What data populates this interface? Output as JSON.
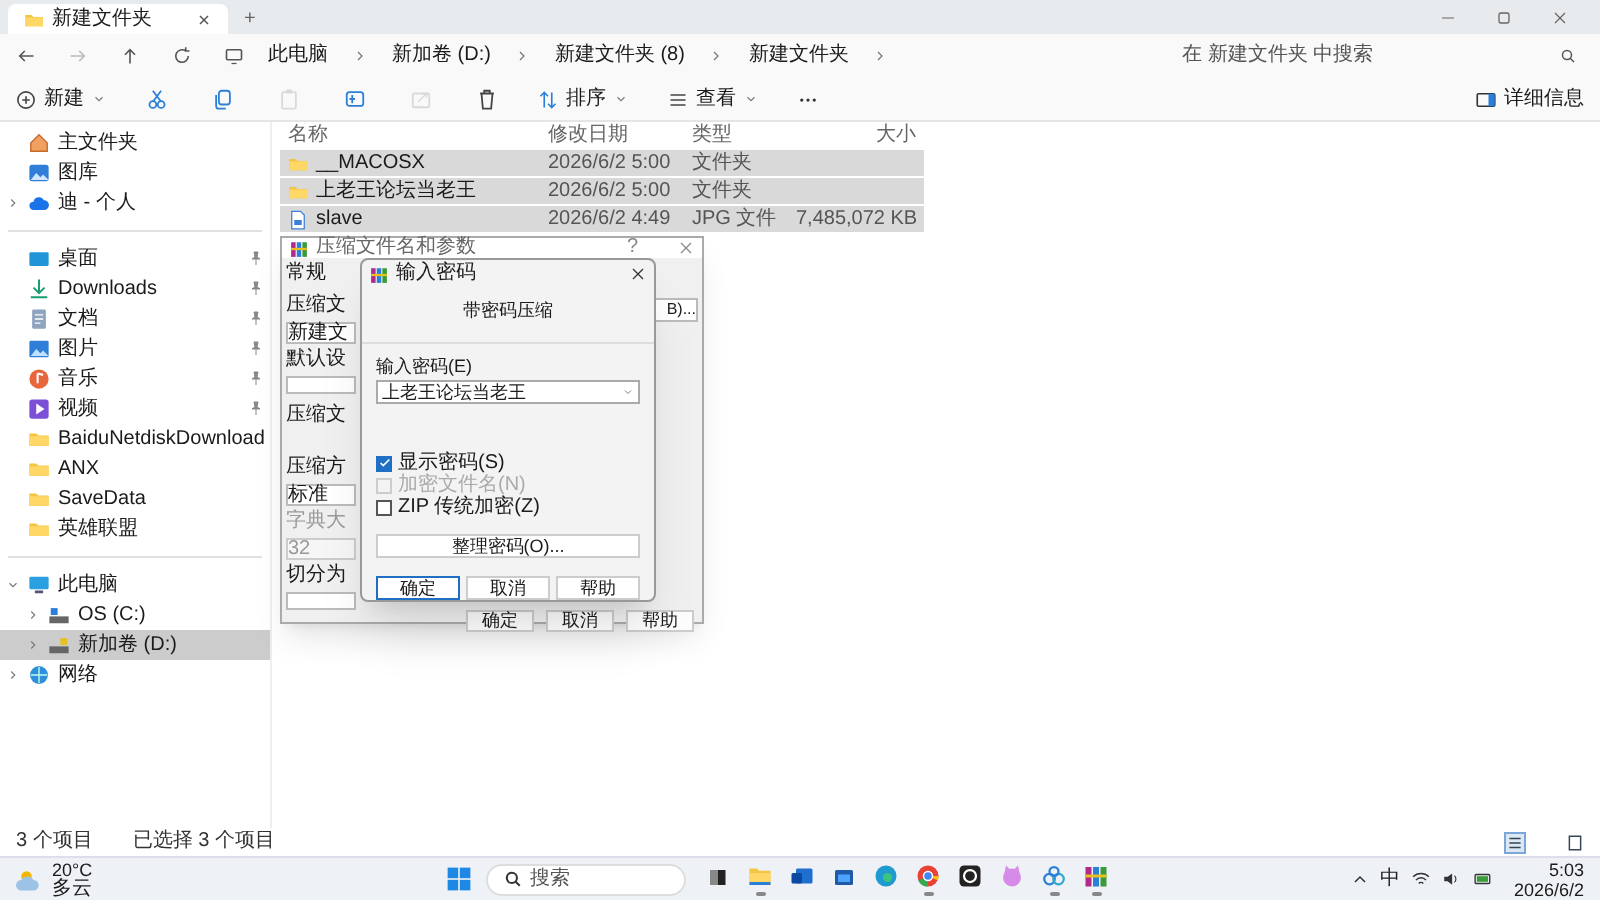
{
  "window": {
    "tab_title": "新建文件夹",
    "new_tab": "+"
  },
  "address_bar": {
    "breadcrumbs": [
      "此电脑",
      "新加卷 (D:)",
      "新建文件夹 (8)",
      "新建文件夹"
    ]
  },
  "search": {
    "placeholder": "在 新建文件夹 中搜索"
  },
  "toolbar": {
    "new_label": "新建",
    "sort_label": "排序",
    "view_label": "查看",
    "details_label": "详细信息",
    "tools": [
      {
        "kind": "cut",
        "disabled": false
      },
      {
        "kind": "copy",
        "disabled": false
      },
      {
        "kind": "paste",
        "disabled": true
      },
      {
        "kind": "rename",
        "disabled": false
      },
      {
        "kind": "share",
        "disabled": true
      },
      {
        "kind": "delete",
        "disabled": false
      }
    ]
  },
  "sidebar": {
    "groups": [
      [
        {
          "label": "主文件夹",
          "kind": "home",
          "pinned": false,
          "selected": false
        },
        {
          "label": "图库",
          "kind": "gallery",
          "pinned": false,
          "selected": false
        },
        {
          "label": "迪 - 个人",
          "kind": "cloud",
          "pinned": false,
          "expanded": false,
          "selected": false
        }
      ],
      [
        {
          "label": "桌面",
          "kind": "desktop",
          "pinned": true,
          "selected": false
        },
        {
          "label": "Downloads",
          "kind": "download",
          "pinned": true,
          "selected": false
        },
        {
          "label": "文档",
          "kind": "document",
          "pinned": true,
          "selected": false
        },
        {
          "label": "图片",
          "kind": "pictures",
          "pinned": true,
          "selected": false
        },
        {
          "label": "音乐",
          "kind": "music",
          "pinned": true,
          "selected": false
        },
        {
          "label": "视频",
          "kind": "video",
          "pinned": true,
          "selected": false
        },
        {
          "label": "BaiduNetdiskDownload",
          "kind": "folder",
          "pinned": false,
          "selected": false
        },
        {
          "label": "ANX",
          "kind": "folder",
          "pinned": false,
          "selected": false
        },
        {
          "label": "SaveData",
          "kind": "folder",
          "pinned": false,
          "selected": false
        },
        {
          "label": "英雄联盟",
          "kind": "folder",
          "pinned": false,
          "selected": false
        }
      ],
      [
        {
          "label": "此电脑",
          "kind": "pc",
          "pinned": false,
          "expanded": true,
          "selected": false,
          "children": [
            {
              "label": "OS (C:)",
              "kind": "drive_c",
              "pinned": false,
              "expanded": false,
              "selected": false
            },
            {
              "label": "新加卷 (D:)",
              "kind": "drive_d",
              "pinned": false,
              "expanded": false,
              "selected": true
            }
          ]
        },
        {
          "label": "网络",
          "kind": "network",
          "pinned": false,
          "expanded": false,
          "selected": false
        }
      ]
    ]
  },
  "file_list": {
    "columns": [
      "名称",
      "修改日期",
      "类型",
      "大小"
    ],
    "rows": [
      {
        "name": "__MACOSX",
        "kind": "folder",
        "modified": "2026/6/2 5:00",
        "type": "文件夹",
        "size": "",
        "selected": true
      },
      {
        "name": "上老王论坛当老王",
        "kind": "folder",
        "modified": "2026/6/2 5:00",
        "type": "文件夹",
        "size": "",
        "selected": true
      },
      {
        "name": "slave",
        "kind": "image",
        "modified": "2026/6/2 4:49",
        "type": "JPG 文件",
        "size": "7,485,072 KB",
        "selected": true
      }
    ]
  },
  "status_bar": {
    "count": "3 个项目",
    "selection": "已选择 3 个项目"
  },
  "archive_dialog": {
    "title": "压缩文件名和参数",
    "help": "?",
    "tab": "常规",
    "labels": [
      "压缩文",
      "新建文",
      "默认设",
      "压缩文",
      "压缩方",
      "标准",
      "字典大",
      "32",
      "切分为"
    ],
    "browse": "B)...",
    "buttons": [
      "确定",
      "取消",
      "帮助"
    ]
  },
  "password_dialog": {
    "title": "输入密码",
    "heading": "带密码压缩",
    "label": "输入密码(E)",
    "value": "上老王论坛当老王",
    "options": [
      {
        "label": "显示密码(S)",
        "checked": true,
        "disabled": false
      },
      {
        "label": "加密文件名(N)",
        "checked": false,
        "disabled": true
      },
      {
        "label": "ZIP 传统加密(Z)",
        "checked": false,
        "disabled": false
      }
    ],
    "organize": "整理密码(O)...",
    "buttons": [
      "确定",
      "取消",
      "帮助"
    ]
  },
  "taskbar": {
    "weather": {
      "temp": "20°C",
      "condition": "多云"
    },
    "search_placeholder": "搜索",
    "apps": [
      {
        "kind": "files",
        "running": false
      },
      {
        "kind": "explorer",
        "running": true
      },
      {
        "kind": "mail",
        "running": false
      },
      {
        "kind": "store",
        "running": false
      },
      {
        "kind": "edge",
        "running": false
      },
      {
        "kind": "chrome",
        "running": true
      },
      {
        "kind": "circle",
        "running": false
      },
      {
        "kind": "cat",
        "running": false
      },
      {
        "kind": "cloud",
        "running": true
      },
      {
        "kind": "archive",
        "running": true
      }
    ],
    "ime": "中",
    "time": "5:03",
    "date": "2026/6/2"
  }
}
